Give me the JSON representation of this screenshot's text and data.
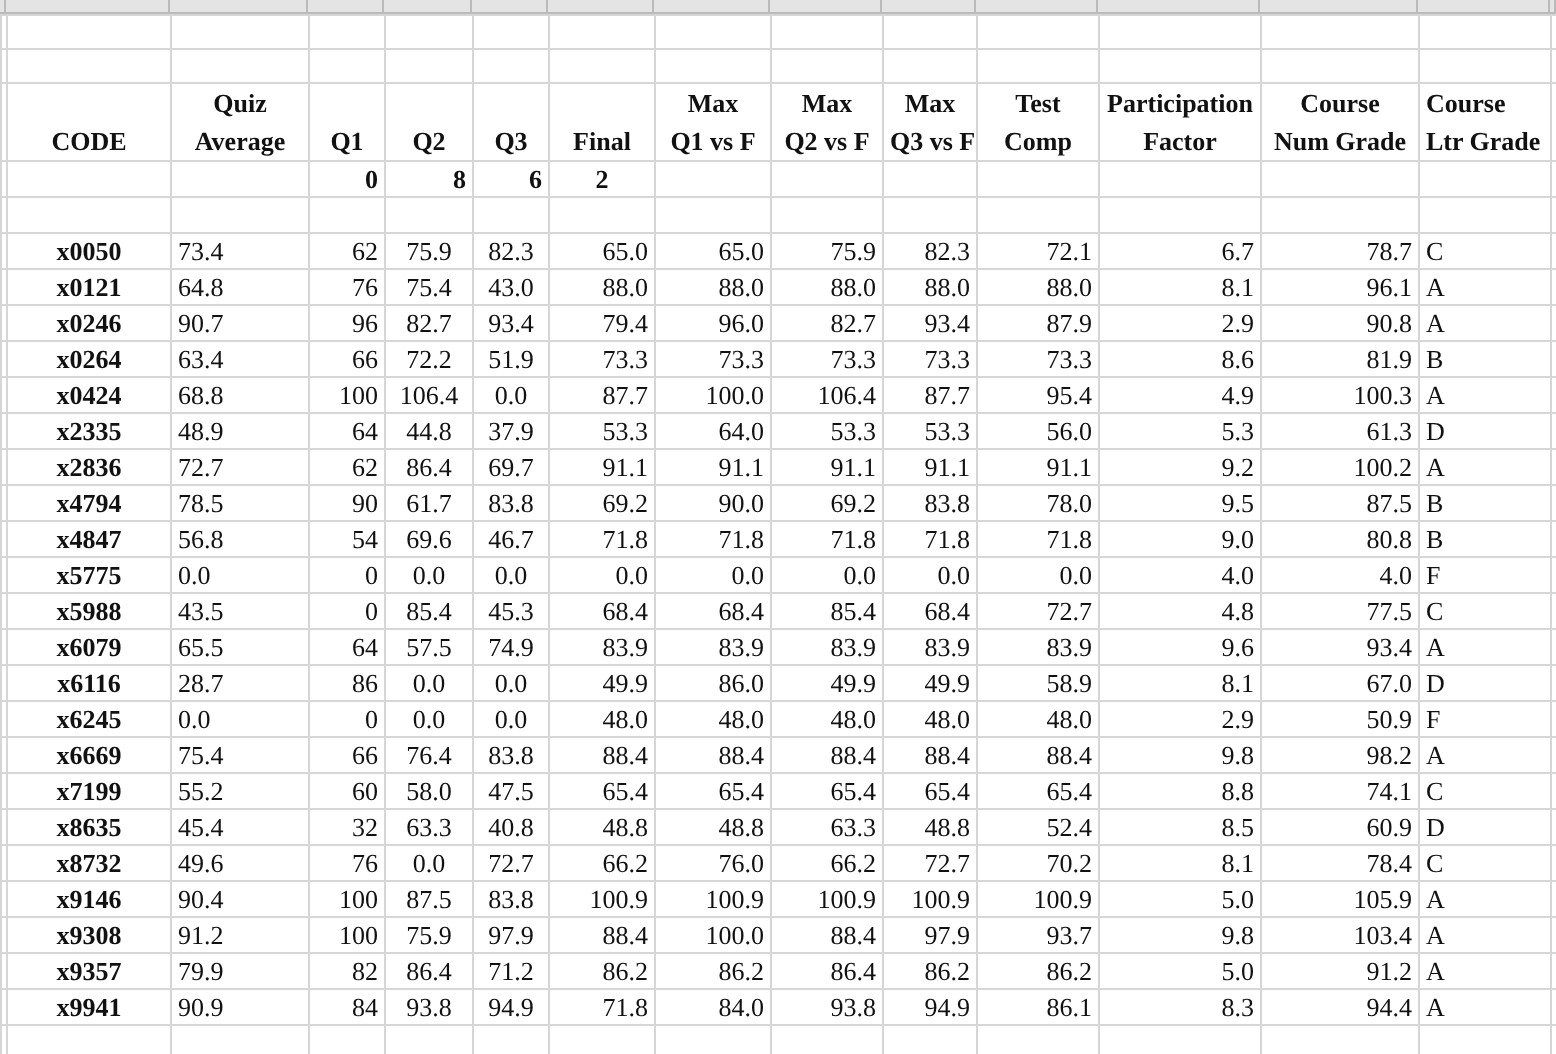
{
  "table": {
    "columns": [
      {
        "header": [
          "CODE"
        ]
      },
      {
        "header": [
          "Quiz",
          "Average"
        ]
      },
      {
        "header": [
          "Q1"
        ],
        "weight": "0"
      },
      {
        "header": [
          "Q2"
        ],
        "weight": "8"
      },
      {
        "header": [
          "Q3"
        ],
        "weight": "6"
      },
      {
        "header": [
          "Final"
        ],
        "weight": "2"
      },
      {
        "header": [
          "Max",
          "Q1 vs F"
        ]
      },
      {
        "header": [
          "Max",
          "Q2 vs F"
        ]
      },
      {
        "header": [
          "Max",
          "Q3 vs F"
        ]
      },
      {
        "header": [
          "Test",
          "Comp"
        ]
      },
      {
        "header": [
          "Participation",
          "Factor"
        ]
      },
      {
        "header": [
          "Course",
          "Num Grade"
        ]
      },
      {
        "header": [
          "Course",
          "Ltr Grade"
        ]
      }
    ],
    "rows": [
      [
        "x0050",
        "73.4",
        "62",
        "75.9",
        "82.3",
        "65.0",
        "65.0",
        "75.9",
        "82.3",
        "72.1",
        "6.7",
        "78.7",
        "C"
      ],
      [
        "x0121",
        "64.8",
        "76",
        "75.4",
        "43.0",
        "88.0",
        "88.0",
        "88.0",
        "88.0",
        "88.0",
        "8.1",
        "96.1",
        "A"
      ],
      [
        "x0246",
        "90.7",
        "96",
        "82.7",
        "93.4",
        "79.4",
        "96.0",
        "82.7",
        "93.4",
        "87.9",
        "2.9",
        "90.8",
        "A"
      ],
      [
        "x0264",
        "63.4",
        "66",
        "72.2",
        "51.9",
        "73.3",
        "73.3",
        "73.3",
        "73.3",
        "73.3",
        "8.6",
        "81.9",
        "B"
      ],
      [
        "x0424",
        "68.8",
        "100",
        "106.4",
        "0.0",
        "87.7",
        "100.0",
        "106.4",
        "87.7",
        "95.4",
        "4.9",
        "100.3",
        "A"
      ],
      [
        "x2335",
        "48.9",
        "64",
        "44.8",
        "37.9",
        "53.3",
        "64.0",
        "53.3",
        "53.3",
        "56.0",
        "5.3",
        "61.3",
        "D"
      ],
      [
        "x2836",
        "72.7",
        "62",
        "86.4",
        "69.7",
        "91.1",
        "91.1",
        "91.1",
        "91.1",
        "91.1",
        "9.2",
        "100.2",
        "A"
      ],
      [
        "x4794",
        "78.5",
        "90",
        "61.7",
        "83.8",
        "69.2",
        "90.0",
        "69.2",
        "83.8",
        "78.0",
        "9.5",
        "87.5",
        "B"
      ],
      [
        "x4847",
        "56.8",
        "54",
        "69.6",
        "46.7",
        "71.8",
        "71.8",
        "71.8",
        "71.8",
        "71.8",
        "9.0",
        "80.8",
        "B"
      ],
      [
        "x5775",
        "0.0",
        "0",
        "0.0",
        "0.0",
        "0.0",
        "0.0",
        "0.0",
        "0.0",
        "0.0",
        "4.0",
        "4.0",
        "F"
      ],
      [
        "x5988",
        "43.5",
        "0",
        "85.4",
        "45.3",
        "68.4",
        "68.4",
        "85.4",
        "68.4",
        "72.7",
        "4.8",
        "77.5",
        "C"
      ],
      [
        "x6079",
        "65.5",
        "64",
        "57.5",
        "74.9",
        "83.9",
        "83.9",
        "83.9",
        "83.9",
        "83.9",
        "9.6",
        "93.4",
        "A"
      ],
      [
        "x6116",
        "28.7",
        "86",
        "0.0",
        "0.0",
        "49.9",
        "86.0",
        "49.9",
        "49.9",
        "58.9",
        "8.1",
        "67.0",
        "D"
      ],
      [
        "x6245",
        "0.0",
        "0",
        "0.0",
        "0.0",
        "48.0",
        "48.0",
        "48.0",
        "48.0",
        "48.0",
        "2.9",
        "50.9",
        "F"
      ],
      [
        "x6669",
        "75.4",
        "66",
        "76.4",
        "83.8",
        "88.4",
        "88.4",
        "88.4",
        "88.4",
        "88.4",
        "9.8",
        "98.2",
        "A"
      ],
      [
        "x7199",
        "55.2",
        "60",
        "58.0",
        "47.5",
        "65.4",
        "65.4",
        "65.4",
        "65.4",
        "65.4",
        "8.8",
        "74.1",
        "C"
      ],
      [
        "x8635",
        "45.4",
        "32",
        "63.3",
        "40.8",
        "48.8",
        "48.8",
        "63.3",
        "48.8",
        "52.4",
        "8.5",
        "60.9",
        "D"
      ],
      [
        "x8732",
        "49.6",
        "76",
        "0.0",
        "72.7",
        "66.2",
        "76.0",
        "66.2",
        "72.7",
        "70.2",
        "8.1",
        "78.4",
        "C"
      ],
      [
        "x9146",
        "90.4",
        "100",
        "87.5",
        "83.8",
        "100.9",
        "100.9",
        "100.9",
        "100.9",
        "100.9",
        "5.0",
        "105.9",
        "A"
      ],
      [
        "x9308",
        "91.2",
        "100",
        "75.9",
        "97.9",
        "88.4",
        "100.0",
        "88.4",
        "97.9",
        "93.7",
        "9.8",
        "103.4",
        "A"
      ],
      [
        "x9357",
        "79.9",
        "82",
        "86.4",
        "71.2",
        "86.2",
        "86.2",
        "86.4",
        "86.2",
        "86.2",
        "5.0",
        "91.2",
        "A"
      ],
      [
        "x9941",
        "90.9",
        "84",
        "93.8",
        "94.9",
        "71.8",
        "84.0",
        "93.8",
        "94.9",
        "86.1",
        "8.3",
        "94.4",
        "A"
      ]
    ]
  }
}
